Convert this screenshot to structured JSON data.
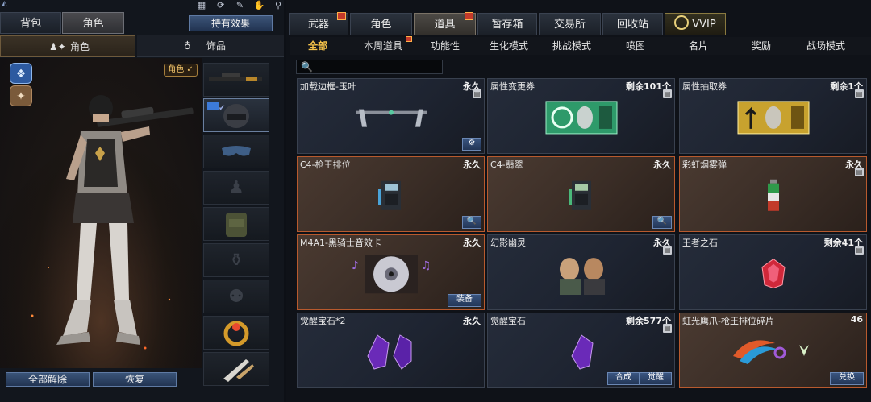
{
  "left": {
    "tabs": [
      {
        "label": "背包",
        "active": false
      },
      {
        "label": "角色",
        "active": true
      }
    ],
    "effect_button": "持有效果",
    "sub_tabs": [
      {
        "label": "角色",
        "icon": "role-icon",
        "active": true
      },
      {
        "label": "饰品",
        "icon": "accessory-icon",
        "active": false
      }
    ],
    "role_badge": "角色 ✓",
    "slots": [
      {
        "name": "slot-rifle",
        "selected": false
      },
      {
        "name": "slot-helmet",
        "selected": true
      },
      {
        "name": "slot-goggles",
        "selected": false
      },
      {
        "name": "slot-body",
        "selected": false
      },
      {
        "name": "slot-backpack",
        "selected": false
      },
      {
        "name": "slot-grenade",
        "selected": false
      },
      {
        "name": "slot-mine",
        "selected": false
      },
      {
        "name": "slot-ring",
        "selected": false
      },
      {
        "name": "slot-knife",
        "selected": false
      }
    ],
    "buttons": {
      "unequip_all": "全部解除",
      "restore": "恢复"
    }
  },
  "right": {
    "categories": [
      {
        "label": "武器",
        "gift": true,
        "active": false
      },
      {
        "label": "角色",
        "gift": false,
        "active": false
      },
      {
        "label": "道具",
        "gift": true,
        "active": true
      },
      {
        "label": "暂存箱",
        "gift": false,
        "active": false
      },
      {
        "label": "交易所",
        "gift": false,
        "active": false
      },
      {
        "label": "回收站",
        "gift": false,
        "active": false
      },
      {
        "label": "VVIP",
        "gift": false,
        "active": false
      }
    ],
    "filters": [
      {
        "label": "全部",
        "active": true
      },
      {
        "label": "本周道具",
        "active": false
      },
      {
        "label": "功能性",
        "active": false
      },
      {
        "label": "生化模式",
        "active": false
      },
      {
        "label": "挑战模式",
        "active": false
      },
      {
        "label": "喷图",
        "active": false
      },
      {
        "label": "名片",
        "active": false
      },
      {
        "label": "奖励",
        "active": false
      },
      {
        "label": "战场模式",
        "active": false
      }
    ],
    "search": {
      "placeholder": ""
    },
    "items": [
      {
        "name": "加载边框-玉叶",
        "duration": "永久",
        "trash": false,
        "buttons": [
          "⚙"
        ],
        "style": "blue",
        "icon": "frame-icon"
      },
      {
        "name": "属性变更券",
        "duration": "剩余101个",
        "trash": true,
        "buttons": [],
        "style": "blue",
        "icon": "ticket-green-icon"
      },
      {
        "name": "属性抽取券",
        "duration": "剩余1个",
        "trash": true,
        "buttons": [],
        "style": "blue",
        "icon": "ticket-gold-icon"
      },
      {
        "name": "C4-枪王排位",
        "duration": "永久",
        "trash": false,
        "buttons": [
          "🔍"
        ],
        "style": "brown",
        "icon": "c4-icon"
      },
      {
        "name": "C4-翡翠",
        "duration": "永久",
        "trash": false,
        "buttons": [
          "🔍"
        ],
        "style": "brown",
        "icon": "c4-green-icon"
      },
      {
        "name": "彩虹烟雾弹",
        "duration": "永久",
        "trash": true,
        "buttons": [],
        "style": "brown",
        "icon": "smoke-grenade-icon"
      },
      {
        "name": "M4A1-黑骑士音效卡",
        "duration": "永久",
        "trash": false,
        "buttons": [
          "装备"
        ],
        "style": "brown",
        "icon": "disc-icon"
      },
      {
        "name": "幻影幽灵",
        "duration": "永久",
        "trash": true,
        "buttons": [],
        "style": "blue",
        "icon": "phantom-icon"
      },
      {
        "name": "王者之石",
        "duration": "剩余41个",
        "trash": true,
        "buttons": [],
        "style": "blue",
        "icon": "red-stone-icon"
      },
      {
        "name": "觉醒宝石*2",
        "duration": "永久",
        "trash": false,
        "buttons": [],
        "style": "blue",
        "icon": "purple-gem-pair-icon"
      },
      {
        "name": "觉醒宝石",
        "duration": "剩余577个",
        "trash": true,
        "buttons": [
          "合成",
          "觉醒"
        ],
        "style": "blue",
        "icon": "purple-gem-icon"
      },
      {
        "name": "虹光鹰爪-枪王排位碎片",
        "duration": "46",
        "trash": false,
        "buttons": [
          "兑换"
        ],
        "style": "brown",
        "icon": "karambit-icon"
      }
    ]
  }
}
